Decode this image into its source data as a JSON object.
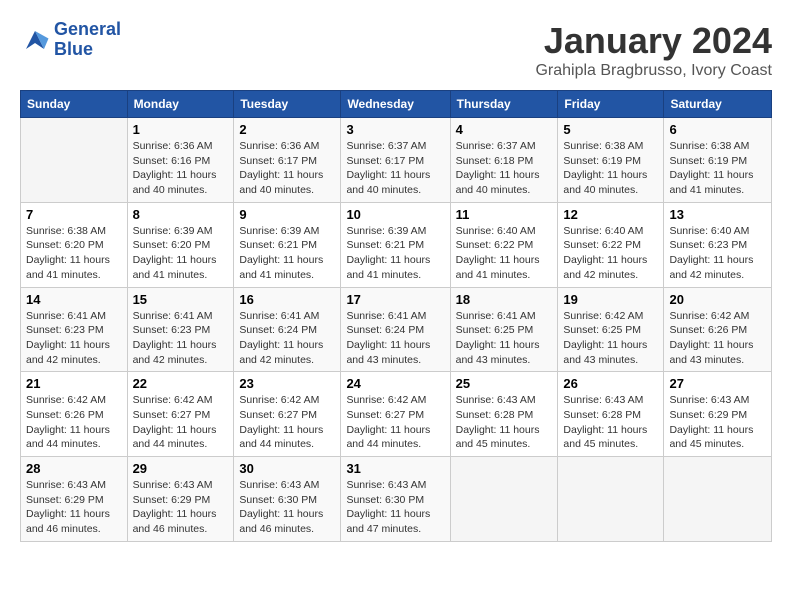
{
  "logo": {
    "line1": "General",
    "line2": "Blue"
  },
  "title": "January 2024",
  "location": "Grahipla Bragbrusso, Ivory Coast",
  "weekdays": [
    "Sunday",
    "Monday",
    "Tuesday",
    "Wednesday",
    "Thursday",
    "Friday",
    "Saturday"
  ],
  "weeks": [
    [
      {
        "day": "",
        "info": ""
      },
      {
        "day": "1",
        "info": "Sunrise: 6:36 AM\nSunset: 6:16 PM\nDaylight: 11 hours\nand 40 minutes."
      },
      {
        "day": "2",
        "info": "Sunrise: 6:36 AM\nSunset: 6:17 PM\nDaylight: 11 hours\nand 40 minutes."
      },
      {
        "day": "3",
        "info": "Sunrise: 6:37 AM\nSunset: 6:17 PM\nDaylight: 11 hours\nand 40 minutes."
      },
      {
        "day": "4",
        "info": "Sunrise: 6:37 AM\nSunset: 6:18 PM\nDaylight: 11 hours\nand 40 minutes."
      },
      {
        "day": "5",
        "info": "Sunrise: 6:38 AM\nSunset: 6:19 PM\nDaylight: 11 hours\nand 40 minutes."
      },
      {
        "day": "6",
        "info": "Sunrise: 6:38 AM\nSunset: 6:19 PM\nDaylight: 11 hours\nand 41 minutes."
      }
    ],
    [
      {
        "day": "7",
        "info": "Sunrise: 6:38 AM\nSunset: 6:20 PM\nDaylight: 11 hours\nand 41 minutes."
      },
      {
        "day": "8",
        "info": "Sunrise: 6:39 AM\nSunset: 6:20 PM\nDaylight: 11 hours\nand 41 minutes."
      },
      {
        "day": "9",
        "info": "Sunrise: 6:39 AM\nSunset: 6:21 PM\nDaylight: 11 hours\nand 41 minutes."
      },
      {
        "day": "10",
        "info": "Sunrise: 6:39 AM\nSunset: 6:21 PM\nDaylight: 11 hours\nand 41 minutes."
      },
      {
        "day": "11",
        "info": "Sunrise: 6:40 AM\nSunset: 6:22 PM\nDaylight: 11 hours\nand 41 minutes."
      },
      {
        "day": "12",
        "info": "Sunrise: 6:40 AM\nSunset: 6:22 PM\nDaylight: 11 hours\nand 42 minutes."
      },
      {
        "day": "13",
        "info": "Sunrise: 6:40 AM\nSunset: 6:23 PM\nDaylight: 11 hours\nand 42 minutes."
      }
    ],
    [
      {
        "day": "14",
        "info": "Sunrise: 6:41 AM\nSunset: 6:23 PM\nDaylight: 11 hours\nand 42 minutes."
      },
      {
        "day": "15",
        "info": "Sunrise: 6:41 AM\nSunset: 6:23 PM\nDaylight: 11 hours\nand 42 minutes."
      },
      {
        "day": "16",
        "info": "Sunrise: 6:41 AM\nSunset: 6:24 PM\nDaylight: 11 hours\nand 42 minutes."
      },
      {
        "day": "17",
        "info": "Sunrise: 6:41 AM\nSunset: 6:24 PM\nDaylight: 11 hours\nand 43 minutes."
      },
      {
        "day": "18",
        "info": "Sunrise: 6:41 AM\nSunset: 6:25 PM\nDaylight: 11 hours\nand 43 minutes."
      },
      {
        "day": "19",
        "info": "Sunrise: 6:42 AM\nSunset: 6:25 PM\nDaylight: 11 hours\nand 43 minutes."
      },
      {
        "day": "20",
        "info": "Sunrise: 6:42 AM\nSunset: 6:26 PM\nDaylight: 11 hours\nand 43 minutes."
      }
    ],
    [
      {
        "day": "21",
        "info": "Sunrise: 6:42 AM\nSunset: 6:26 PM\nDaylight: 11 hours\nand 44 minutes."
      },
      {
        "day": "22",
        "info": "Sunrise: 6:42 AM\nSunset: 6:27 PM\nDaylight: 11 hours\nand 44 minutes."
      },
      {
        "day": "23",
        "info": "Sunrise: 6:42 AM\nSunset: 6:27 PM\nDaylight: 11 hours\nand 44 minutes."
      },
      {
        "day": "24",
        "info": "Sunrise: 6:42 AM\nSunset: 6:27 PM\nDaylight: 11 hours\nand 44 minutes."
      },
      {
        "day": "25",
        "info": "Sunrise: 6:43 AM\nSunset: 6:28 PM\nDaylight: 11 hours\nand 45 minutes."
      },
      {
        "day": "26",
        "info": "Sunrise: 6:43 AM\nSunset: 6:28 PM\nDaylight: 11 hours\nand 45 minutes."
      },
      {
        "day": "27",
        "info": "Sunrise: 6:43 AM\nSunset: 6:29 PM\nDaylight: 11 hours\nand 45 minutes."
      }
    ],
    [
      {
        "day": "28",
        "info": "Sunrise: 6:43 AM\nSunset: 6:29 PM\nDaylight: 11 hours\nand 46 minutes."
      },
      {
        "day": "29",
        "info": "Sunrise: 6:43 AM\nSunset: 6:29 PM\nDaylight: 11 hours\nand 46 minutes."
      },
      {
        "day": "30",
        "info": "Sunrise: 6:43 AM\nSunset: 6:30 PM\nDaylight: 11 hours\nand 46 minutes."
      },
      {
        "day": "31",
        "info": "Sunrise: 6:43 AM\nSunset: 6:30 PM\nDaylight: 11 hours\nand 47 minutes."
      },
      {
        "day": "",
        "info": ""
      },
      {
        "day": "",
        "info": ""
      },
      {
        "day": "",
        "info": ""
      }
    ]
  ]
}
